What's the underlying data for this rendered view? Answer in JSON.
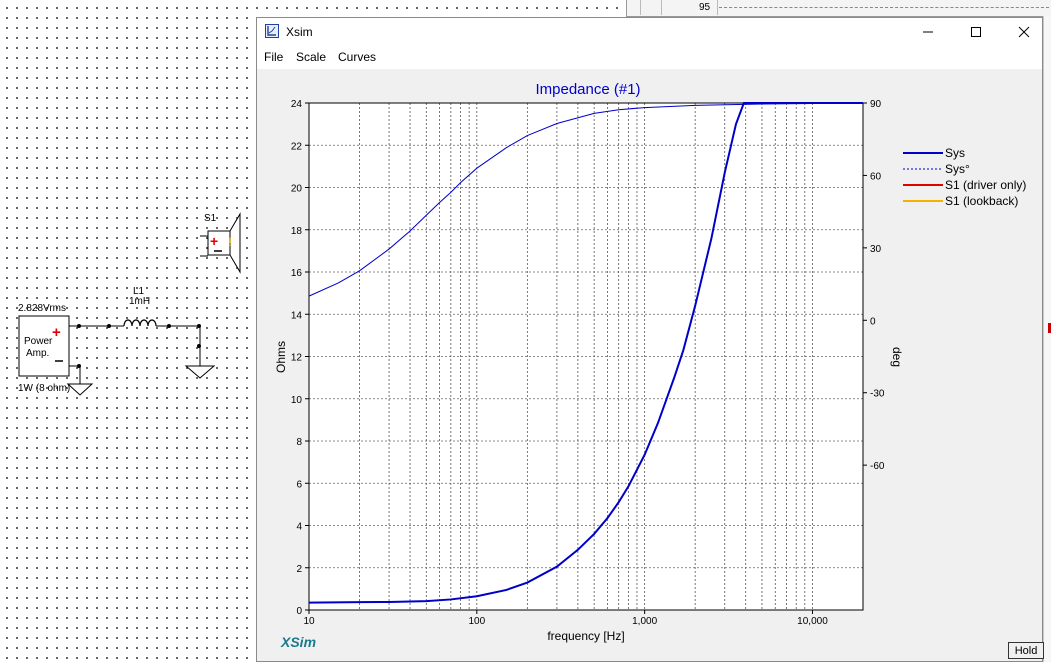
{
  "schematic": {
    "speaker_label": "S1",
    "inductor_label": "L1",
    "inductor_value": "1mH",
    "source_voltage": "2.828Vrms",
    "source_name_line1": "Power",
    "source_name_line2": "Amp.",
    "source_power": "1W (8 ohm)"
  },
  "background_window": {
    "value": "95"
  },
  "window": {
    "title": "Xsim",
    "menu": [
      "File",
      "Scale",
      "Curves"
    ]
  },
  "brand": "XSim",
  "hold_label": "Hold",
  "chart_data": {
    "type": "line",
    "title": "Impedance (#1)",
    "xlabel": "frequency [Hz]",
    "ylabel": "Ohms",
    "y2label": "deg",
    "x_scale": "log",
    "xlim": [
      10,
      20000
    ],
    "ylim": [
      0,
      24
    ],
    "y2lim": [
      -120,
      90
    ],
    "grid": true,
    "legend_position": "right-outside",
    "x_tick_labels": [
      "10",
      "100",
      "1,000",
      "10,000"
    ],
    "x_ticks": [
      10,
      100,
      1000,
      10000
    ],
    "y_ticks": [
      0,
      2,
      4,
      6,
      8,
      10,
      12,
      14,
      16,
      18,
      20,
      22,
      24
    ],
    "y2_ticks": [
      -60,
      -30,
      0,
      30,
      60,
      90
    ],
    "series": [
      {
        "name": "Sys",
        "axis": "left",
        "color": "#0000c8",
        "style": "solid-thick",
        "x": [
          10,
          20,
          30,
          50,
          70,
          100,
          150,
          200,
          300,
          400,
          500,
          600,
          700,
          800,
          1000,
          1200,
          1500,
          1700,
          2000,
          2500,
          3000,
          3500,
          3900,
          4100,
          5000,
          7000,
          10000,
          15000,
          20000
        ],
        "y": [
          0.35,
          0.37,
          0.38,
          0.42,
          0.5,
          0.65,
          0.95,
          1.3,
          2.05,
          2.85,
          3.6,
          4.35,
          5.1,
          5.85,
          7.35,
          8.85,
          11.0,
          12.3,
          14.4,
          17.6,
          20.7,
          23.0,
          24.0,
          24.0,
          24.0,
          24.0,
          24.0,
          24.0,
          24.0
        ]
      },
      {
        "name": "Sys°",
        "axis": "right",
        "color": "#0000c8",
        "style": "dashed",
        "x": [
          10,
          15,
          20,
          30,
          40,
          50,
          60,
          70,
          80,
          100,
          150,
          200,
          300,
          500,
          700,
          1000,
          2000,
          5000,
          10000,
          20000
        ],
        "y": [
          10,
          15.5,
          20.5,
          29.5,
          37,
          43.5,
          48.8,
          53,
          57,
          63,
          71.5,
          76.5,
          81.5,
          85.7,
          87.2,
          88.1,
          89.0,
          89.6,
          89.8,
          89.9
        ]
      },
      {
        "name": "S1 (driver only)",
        "axis": "left",
        "color": "#e00000",
        "style": "solid",
        "x": [],
        "y": []
      },
      {
        "name": "S1 (lookback)",
        "axis": "left",
        "color": "#f0b400",
        "style": "solid",
        "x": [],
        "y": []
      }
    ]
  }
}
